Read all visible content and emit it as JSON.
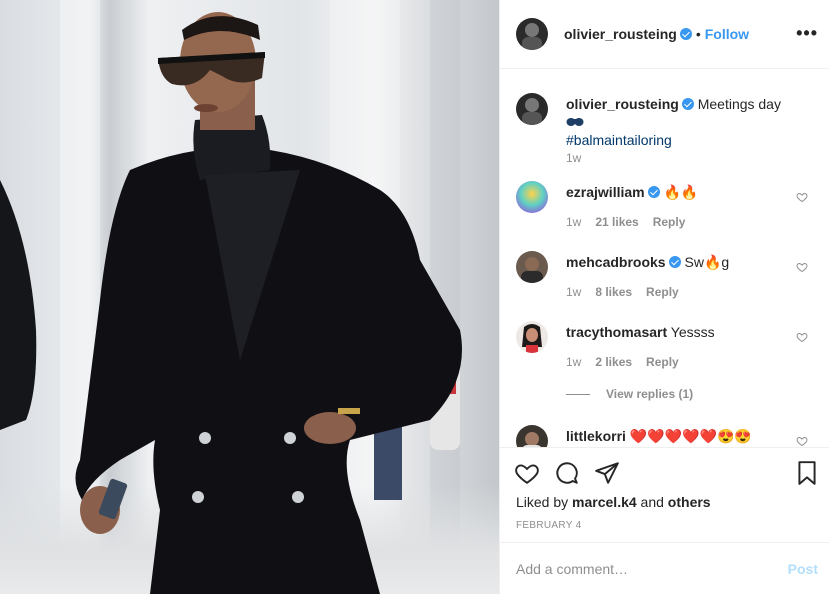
{
  "post": {
    "author": "olivier_rousteing",
    "follow_label": "Follow",
    "dot": "•",
    "more_label": "•••"
  },
  "caption": {
    "author": "olivier_rousteing",
    "text": "Meetings day",
    "hashtag": "#balmaintailoring",
    "time": "1w"
  },
  "comments": [
    {
      "user": "ezrajwilliam",
      "verified": true,
      "text": "",
      "emoji": [
        "fire",
        "fire"
      ],
      "time": "1w",
      "likes": "21 likes",
      "reply": "Reply"
    },
    {
      "user": "mehcadbrooks",
      "verified": true,
      "text_pre": "Sw",
      "emoji": [
        "fire"
      ],
      "text_post": "g",
      "time": "1w",
      "likes": "8 likes",
      "reply": "Reply"
    },
    {
      "user": "tracythomasart",
      "verified": false,
      "text": "Yessss",
      "time": "1w",
      "likes": "2 likes",
      "reply": "Reply"
    },
    {
      "user": "littlekorri",
      "verified": false,
      "text": "",
      "emoji": [
        "heart",
        "heart",
        "heart",
        "heart",
        "heart",
        "heart-eyes",
        "heart-eyes"
      ]
    }
  ],
  "view_replies": "View replies (1)",
  "likes_line": {
    "prefix": "Liked by",
    "user": "marcel.k4",
    "and": "and",
    "others": "others"
  },
  "date": "FEBRUARY 4",
  "add_comment": {
    "placeholder": "Add a comment…",
    "post_label": "Post"
  },
  "colors": {
    "accent": "#3897f0",
    "muted": "#8e8e8e",
    "text": "#262626",
    "post_disabled": "#b2dffc"
  }
}
